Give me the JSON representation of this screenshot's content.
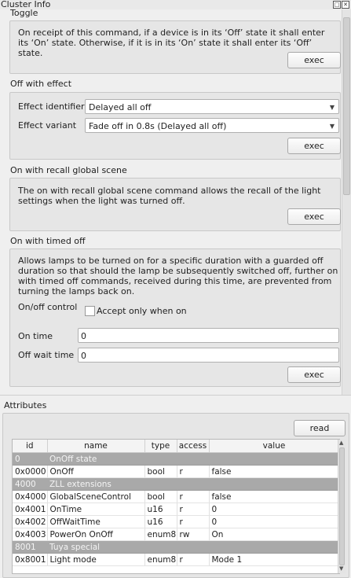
{
  "window": {
    "title": "Cluster Info"
  },
  "toggle": {
    "heading": "Toggle",
    "description": "On receipt of this command, if a device is in its ‘Off’ state it shall enter its ‘On’ state. Otherwise, if it is in its ‘On’ state it shall enter its ‘Off’ state.",
    "exec_label": "exec"
  },
  "off_with_effect": {
    "heading": "Off with effect",
    "effect_identifier_label": "Effect identifier",
    "effect_identifier_value": "Delayed all off",
    "effect_variant_label": "Effect variant",
    "effect_variant_value": "Fade off in 0.8s (Delayed all off)",
    "exec_label": "exec"
  },
  "recall_scene": {
    "heading": "On with recall global scene",
    "description": "The on with recall global scene command allows the recall of the light settings when the light was turned off.",
    "exec_label": "exec"
  },
  "timed_off": {
    "heading": "On with timed off",
    "description": "Allows lamps to be turned on for a specific duration with a guarded off duration so that should the lamp be subsequently switched off, further on with timed off commands, received during this time, are prevented from turning the lamps back on.",
    "onoff_control_label": "On/off control",
    "accept_only_label": "Accept only when on",
    "on_time_label": "On time",
    "on_time_value": "0",
    "off_wait_label": "Off wait time",
    "off_wait_value": "0",
    "exec_label": "exec"
  },
  "attributes": {
    "heading": "Attributes",
    "read_label": "read",
    "columns": [
      "id",
      "name",
      "type",
      "access",
      "value"
    ],
    "rows": [
      {
        "group": true,
        "id": "0",
        "name": "OnOff state"
      },
      {
        "id": "0x0000",
        "name": "OnOff",
        "type": "bool",
        "access": "r",
        "value": "false"
      },
      {
        "group": true,
        "id": "4000",
        "name": "ZLL extensions"
      },
      {
        "id": "0x4000",
        "name": "GlobalSceneControl",
        "type": "bool",
        "access": "r",
        "value": "false"
      },
      {
        "id": "0x4001",
        "name": "OnTime",
        "type": "u16",
        "access": "r",
        "value": "0"
      },
      {
        "id": "0x4002",
        "name": "OffWaitTime",
        "type": "u16",
        "access": "r",
        "value": "0"
      },
      {
        "id": "0x4003",
        "name": "PowerOn OnOff",
        "type": "enum8",
        "access": "rw",
        "value": "On"
      },
      {
        "group": true,
        "id": "8001",
        "name": "Tuya special"
      },
      {
        "id": "0x8001",
        "name": "Light mode",
        "type": "enum8",
        "access": "r",
        "value": "Mode 1"
      }
    ]
  },
  "icons": {
    "float": "float-icon",
    "close": "close-icon",
    "dropdown": "chevron-down-icon"
  }
}
